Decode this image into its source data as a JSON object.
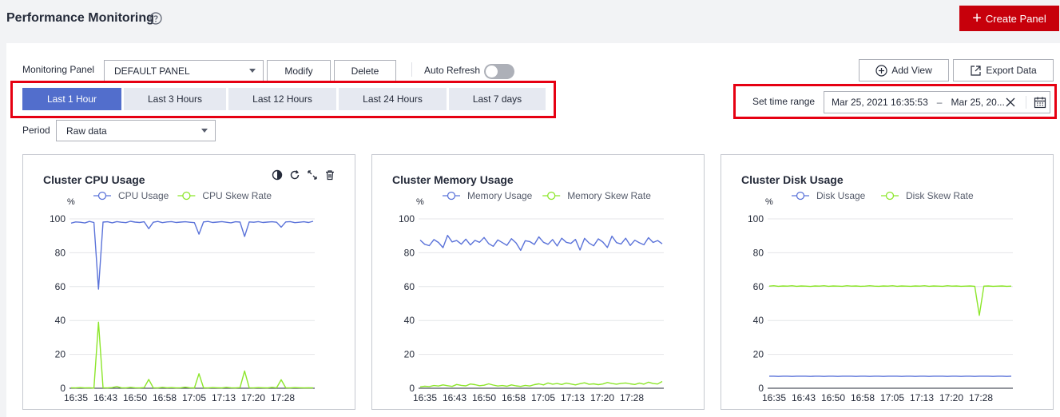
{
  "header": {
    "title": "Performance Monitoring",
    "create_label": "Create Panel",
    "accent": "#c7000b"
  },
  "toolbar": {
    "monitoring_panel_label": "Monitoring Panel",
    "monitoring_panel_value": "DEFAULT PANEL",
    "modify_label": "Modify",
    "delete_label": "Delete",
    "auto_refresh_label": "Auto Refresh",
    "auto_refresh_on": false,
    "add_view_label": "Add View",
    "export_label": "Export Data"
  },
  "time_ranges": {
    "options": [
      "Last 1 Hour",
      "Last 3 Hours",
      "Last 12 Hours",
      "Last 24 Hours",
      "Last 7 days"
    ],
    "selected": "Last 1 Hour",
    "set_range_label": "Set time range",
    "start": "Mar 25, 2021 16:35:53",
    "end": "Mar 25, 20...",
    "separator": "–"
  },
  "period": {
    "label": "Period",
    "value": "Raw data"
  },
  "chart_data": [
    {
      "type": "line",
      "title": "Cluster CPU Usage",
      "ylabel": "%",
      "ylim": [
        0,
        100
      ],
      "yticks": [
        0,
        20,
        40,
        60,
        80,
        100
      ],
      "xticks": [
        "16:35",
        "16:43",
        "16:50",
        "16:58",
        "17:05",
        "17:13",
        "17:20",
        "17:28"
      ],
      "grid": true,
      "legend": "top",
      "series": [
        {
          "name": "CPU Usage",
          "color": "#5b73d9",
          "values": [
            97.5,
            98.2,
            98.0,
            97.6,
            98.5,
            97.9,
            58.5,
            98.1,
            98.3,
            97.7,
            98.4,
            98.0,
            97.8,
            98.6,
            98.1,
            97.9,
            98.3,
            94.2,
            98.0,
            98.5,
            97.8,
            98.2,
            98.4,
            97.9,
            98.1,
            98.3,
            98.0,
            97.8,
            91.0,
            98.2,
            98.5,
            97.9,
            98.1,
            98.4,
            98.0,
            97.7,
            98.3,
            98.1,
            89.6,
            98.2,
            98.0,
            98.4,
            97.9,
            98.1,
            98.3,
            98.0,
            95.1,
            98.2,
            98.4,
            97.8,
            98.0,
            98.3,
            97.9,
            98.6
          ]
        },
        {
          "name": "CPU Skew Rate",
          "color": "#8ce62a",
          "values": [
            0.3,
            0.2,
            0.4,
            0.2,
            0.3,
            0.1,
            39.0,
            0.3,
            0.2,
            0.4,
            1.0,
            0.3,
            0.2,
            0.5,
            0.3,
            0.2,
            0.4,
            5.2,
            0.3,
            0.2,
            0.5,
            0.3,
            0.4,
            0.2,
            0.3,
            0.6,
            0.3,
            0.2,
            8.6,
            0.3,
            0.2,
            0.4,
            0.3,
            0.2,
            0.5,
            0.3,
            0.2,
            0.4,
            10.2,
            0.3,
            0.2,
            0.4,
            0.3,
            0.2,
            0.5,
            0.3,
            5.0,
            0.3,
            0.2,
            0.4,
            0.3,
            0.2,
            0.3,
            0.2
          ]
        }
      ]
    },
    {
      "type": "line",
      "title": "Cluster Memory Usage",
      "ylabel": "%",
      "ylim": [
        0,
        100
      ],
      "yticks": [
        0,
        20,
        40,
        60,
        80,
        100
      ],
      "xticks": [
        "16:35",
        "16:43",
        "16:50",
        "16:58",
        "17:05",
        "17:13",
        "17:20",
        "17:28"
      ],
      "grid": true,
      "legend": "top",
      "series": [
        {
          "name": "Memory Usage",
          "color": "#5b73d9",
          "values": [
            87.5,
            85.0,
            84.2,
            87.8,
            86.1,
            83.0,
            90.3,
            86.4,
            87.2,
            85.1,
            88.0,
            84.6,
            87.3,
            86.2,
            89.0,
            85.4,
            83.8,
            87.6,
            86.0,
            84.4,
            88.3,
            85.8,
            81.4,
            87.1,
            86.6,
            84.9,
            89.4,
            86.2,
            85.0,
            87.8,
            84.0,
            88.6,
            86.2,
            85.5,
            87.9,
            81.6,
            88.5,
            85.7,
            84.1,
            88.2,
            86.3,
            83.1,
            89.8,
            86.0,
            85.2,
            88.6,
            84.3,
            87.4,
            85.9,
            84.7,
            88.9,
            86.1,
            87.2,
            85.3
          ]
        },
        {
          "name": "Memory Skew Rate",
          "color": "#8ce62a",
          "values": [
            0.8,
            1.2,
            1.0,
            1.6,
            1.3,
            2.0,
            1.5,
            1.1,
            2.2,
            1.7,
            1.4,
            2.5,
            2.1,
            1.5,
            1.8,
            2.6,
            1.9,
            1.3,
            1.6,
            1.2,
            2.0,
            1.4,
            1.1,
            1.7,
            1.3,
            2.1,
            2.6,
            2.0,
            3.1,
            2.4,
            2.8,
            2.2,
            3.0,
            2.5,
            2.0,
            2.7,
            3.2,
            2.3,
            2.6,
            2.1,
            2.5,
            3.4,
            2.8,
            2.4,
            2.9,
            3.1,
            2.6,
            2.2,
            3.0,
            2.4,
            3.6,
            2.8,
            2.5,
            4.0
          ]
        }
      ]
    },
    {
      "type": "line",
      "title": "Cluster Disk Usage",
      "ylabel": "%",
      "ylim": [
        0,
        100
      ],
      "yticks": [
        0,
        20,
        40,
        60,
        80,
        100
      ],
      "xticks": [
        "16:35",
        "16:43",
        "16:50",
        "16:58",
        "17:05",
        "17:13",
        "17:20",
        "17:28"
      ],
      "grid": true,
      "legend": "top",
      "series": [
        {
          "name": "Disk Usage",
          "color": "#5b73d9",
          "values": [
            7.1,
            7.1,
            7.0,
            7.1,
            7.1,
            7.0,
            7.1,
            7.1,
            7.1,
            7.0,
            7.1,
            7.1,
            7.0,
            7.1,
            7.1,
            7.0,
            7.1,
            7.1,
            7.1,
            7.0,
            7.1,
            7.1,
            7.0,
            7.1,
            7.1,
            7.0,
            7.1,
            7.1,
            7.1,
            7.0,
            7.1,
            7.1,
            7.0,
            7.1,
            7.1,
            7.0,
            7.1,
            7.1,
            7.1,
            7.0,
            7.1,
            7.1,
            7.0,
            7.1,
            7.1,
            7.0,
            7.1,
            7.1,
            7.1,
            7.0,
            7.1,
            7.1,
            7.0,
            7.1
          ]
        },
        {
          "name": "Disk Skew Rate",
          "color": "#8ce62a",
          "values": [
            60.3,
            60.5,
            60.2,
            60.4,
            60.3,
            60.5,
            60.2,
            60.4,
            60.3,
            60.1,
            60.4,
            60.3,
            60.5,
            60.2,
            60.4,
            60.3,
            60.2,
            60.5,
            60.3,
            60.4,
            60.2,
            60.3,
            60.5,
            60.3,
            60.2,
            60.4,
            60.3,
            60.5,
            60.2,
            60.4,
            60.3,
            60.2,
            60.4,
            60.3,
            60.5,
            60.2,
            60.4,
            60.3,
            60.2,
            60.5,
            60.3,
            60.4,
            60.2,
            60.3,
            60.4,
            60.2,
            43.0,
            60.3,
            60.4,
            60.2,
            60.3,
            60.4,
            60.2,
            60.3
          ]
        }
      ]
    }
  ]
}
